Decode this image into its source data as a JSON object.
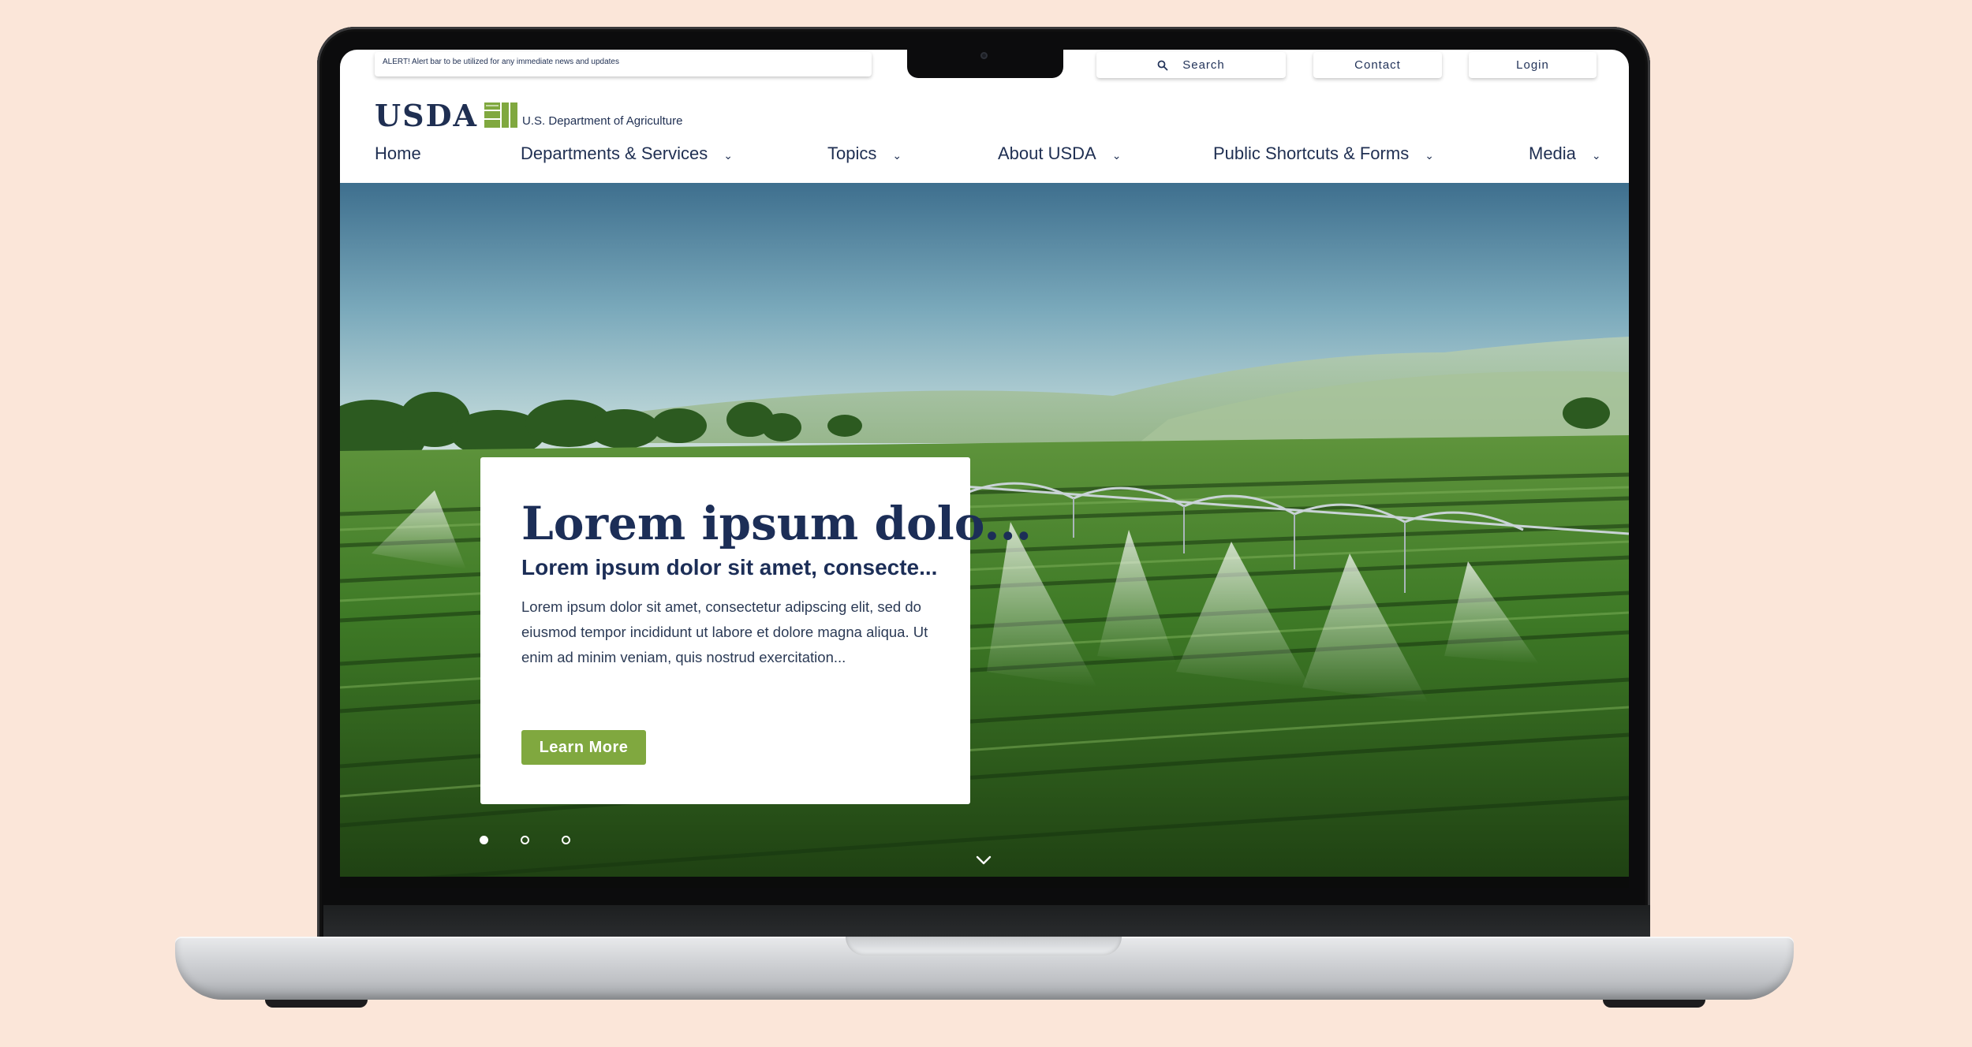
{
  "alert": {
    "text": "ALERT! Alert bar to be utilized for any immediate news and updates"
  },
  "utility": {
    "search_label": "Search",
    "contact_label": "Contact",
    "login_label": "Login"
  },
  "logo": {
    "wordmark": "USDA",
    "subtitle": "U.S. Department of Agriculture",
    "brand_color": "#80a83f",
    "text_color": "#1f2f52"
  },
  "nav": {
    "items": [
      {
        "label": "Home",
        "has_dropdown": false
      },
      {
        "label": "Departments & Services",
        "has_dropdown": true
      },
      {
        "label": "Topics",
        "has_dropdown": true
      },
      {
        "label": "About USDA",
        "has_dropdown": true
      },
      {
        "label": "Public Shortcuts & Forms",
        "has_dropdown": true
      },
      {
        "label": "Media",
        "has_dropdown": true
      }
    ],
    "caret_glyph": "⌄"
  },
  "hero": {
    "title": "Lorem ipsum dolo...",
    "subtitle": "Lorem ipsum dolor sit amet, consecte...",
    "body": "Lorem ipsum dolor sit amet, consectetur adipscing elit, sed do eiusmod tempor incididunt ut labore et dolore magna aliqua. Ut enim ad minim veniam, quis nostrud exercitation...",
    "cta_label": "Learn More",
    "cta_color": "#80a83f",
    "carousel": {
      "slide_count": 3,
      "active_index": 0
    },
    "image_description_icon": "irrigation-field-image"
  }
}
